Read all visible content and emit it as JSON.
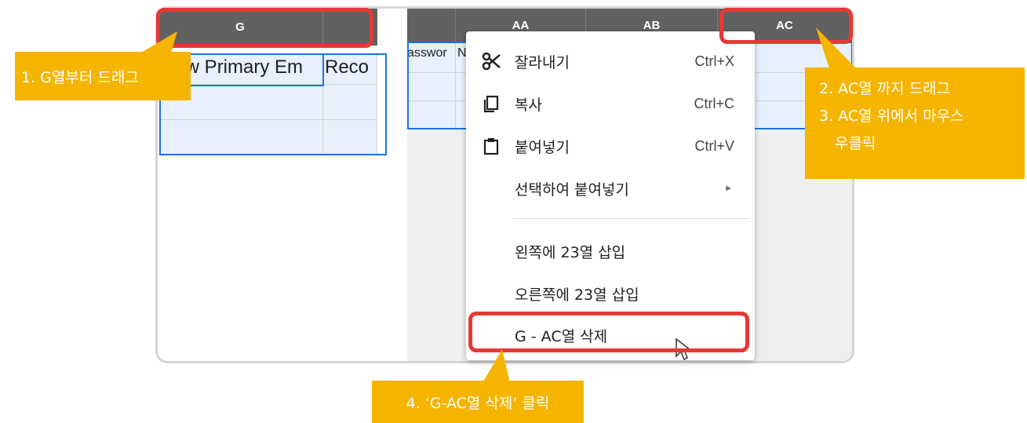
{
  "sheet_left": {
    "col_g": "G",
    "cell_g1": "New Primary Em",
    "cell_h1": "Reco"
  },
  "sheet_right": {
    "col_aa": "AA",
    "col_ab": "AB",
    "col_ac": "AC",
    "cell_partial": "asswor",
    "cell_partial2": "N"
  },
  "context_menu": {
    "cut": {
      "label": "잘라내기",
      "shortcut": "Ctrl+X",
      "icon": "scissors-icon"
    },
    "copy": {
      "label": "복사",
      "shortcut": "Ctrl+C",
      "icon": "copy-icon"
    },
    "paste": {
      "label": "붙여넣기",
      "shortcut": "Ctrl+V",
      "icon": "clipboard-icon"
    },
    "paste_special": {
      "label": "선택하여 붙여넣기",
      "arrow": "►"
    },
    "insert_left": {
      "label": "왼쪽에 23열 삽입"
    },
    "insert_right": {
      "label": "오른쪽에 23열 삽입"
    },
    "delete_cols": {
      "label": "G - AC열 삭제"
    }
  },
  "callouts": {
    "step1": "1. G열부터 드래그",
    "step2": "2. AC열 까지 드래그",
    "step3_line1": "3. AC열 위에서 마우스",
    "step3_line2": "우클릭",
    "step4": "4. ‘G-AC열 삭제’ 클릭"
  },
  "colors": {
    "callout": "#f5b400",
    "highlight": "#e53935",
    "selection": "#1a73e8",
    "header": "#616161"
  }
}
